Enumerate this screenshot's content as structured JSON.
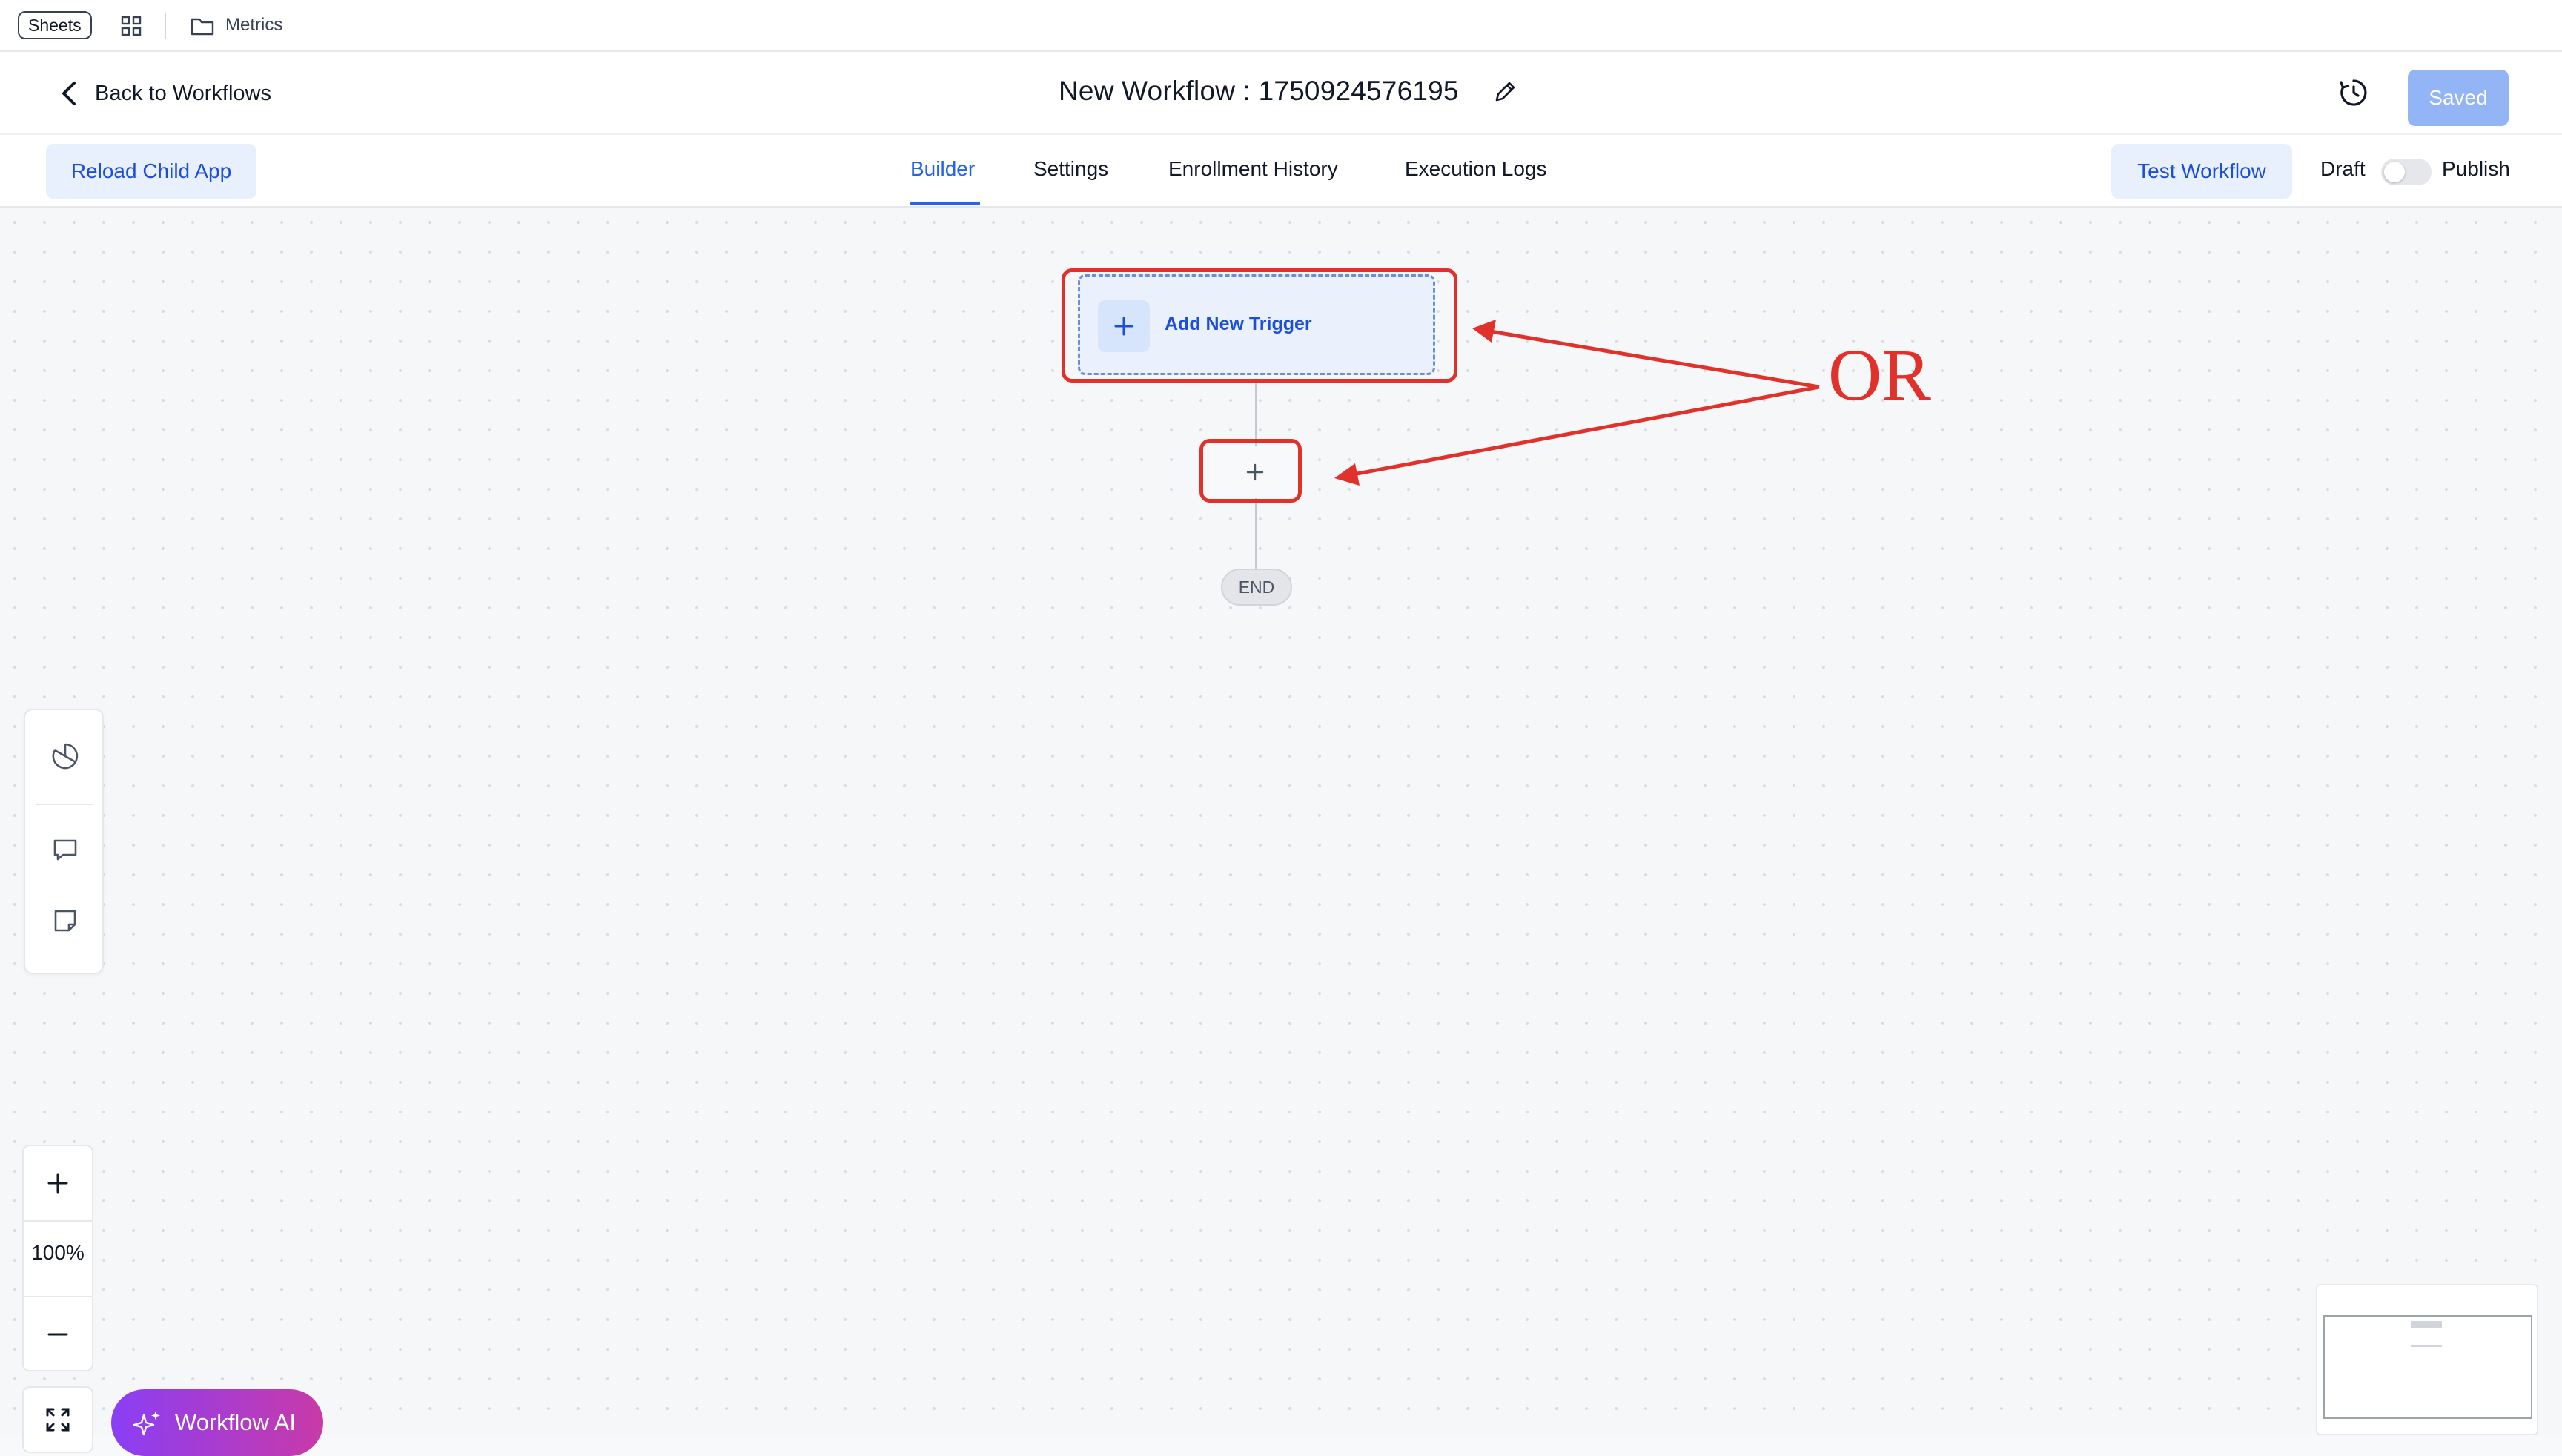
{
  "topbar": {
    "sheets_label": "Sheets",
    "breadcrumb_folder": "Metrics"
  },
  "header": {
    "back_label": "Back to Workflows",
    "title": "New Workflow : 1750924576195",
    "saved_label": "Saved"
  },
  "toolbar": {
    "reload_label": "Reload Child App",
    "tabs": [
      {
        "label": "Builder",
        "active": true
      },
      {
        "label": "Settings",
        "active": false
      },
      {
        "label": "Enrollment History",
        "active": false
      },
      {
        "label": "Execution Logs",
        "active": false
      }
    ],
    "test_label": "Test Workflow",
    "draft_label": "Draft",
    "publish_label": "Publish",
    "published": false
  },
  "canvas": {
    "trigger_label": "Add New Trigger",
    "end_label": "END",
    "annotation_text": "OR"
  },
  "zoom": {
    "level": "100%"
  },
  "ai": {
    "label": "Workflow AI"
  },
  "colors": {
    "accent": "#2563eb",
    "annotation": "#e0322a",
    "saved_button": "#93b4f5",
    "ai_gradient_start": "#8a3ef5",
    "ai_gradient_end": "#c83aa8"
  },
  "icons": {
    "grid": "apps-grid-icon",
    "folder": "folder-icon",
    "back": "chevron-left-icon",
    "edit": "pencil-icon",
    "history": "clock-history-icon",
    "tool_1": "pie-chart-icon",
    "tool_2": "comment-icon",
    "tool_3": "sticky-note-icon",
    "zoom_in": "plus-icon",
    "zoom_out": "minus-icon",
    "fit": "expand-icon",
    "ai": "sparkles-icon"
  }
}
